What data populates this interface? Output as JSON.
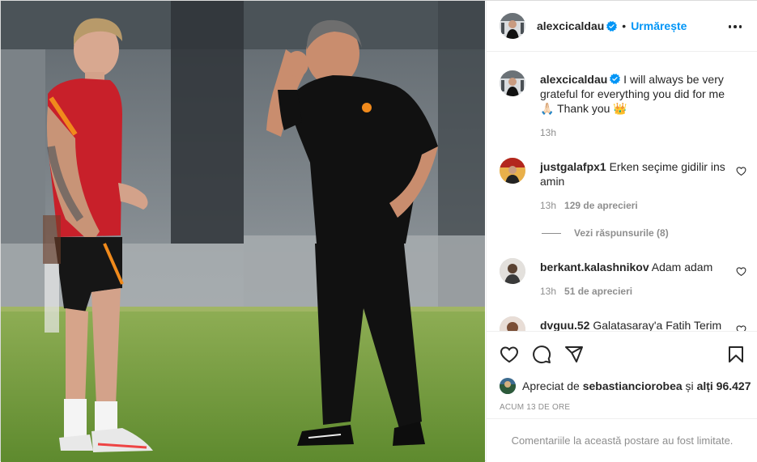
{
  "post": {
    "author": "alexcicaldau",
    "follow_label": "Urmărește",
    "dot": "•"
  },
  "caption": {
    "username": "alexcicaldau",
    "text": "I will always be very grateful for everything you did for me🙏🏻 Thank you 👑",
    "time": "13h"
  },
  "comments": [
    {
      "username": "justgalafpx1",
      "text": "Erken seçime gidilir ins amin",
      "time": "13h",
      "likes": "129 de aprecieri"
    },
    {
      "username": "berkant.kalashnikov",
      "text": "Adam adam",
      "time": "13h",
      "likes": "51 de aprecieri"
    },
    {
      "username": "dvguu.52",
      "text": "Galatasaray'a Fatih Terim"
    }
  ],
  "view_replies": "Vezi răspunsurile (8)",
  "likes_line": {
    "prefix": "Apreciat de",
    "user": "sebastiancіorobea",
    "and": "și",
    "others": "alți 96.427"
  },
  "timestamp": "Acum 13 de ore",
  "comments_limited": "Comentariile la această postare au fost limitate.",
  "colors": {
    "accent": "#0095f6",
    "text": "#262626",
    "secondary": "#8e8e8e",
    "border": "#efefef"
  },
  "icons": [
    "verified-badge-icon",
    "more-options-icon",
    "heart-icon",
    "comment-icon",
    "share-icon",
    "bookmark-icon"
  ]
}
